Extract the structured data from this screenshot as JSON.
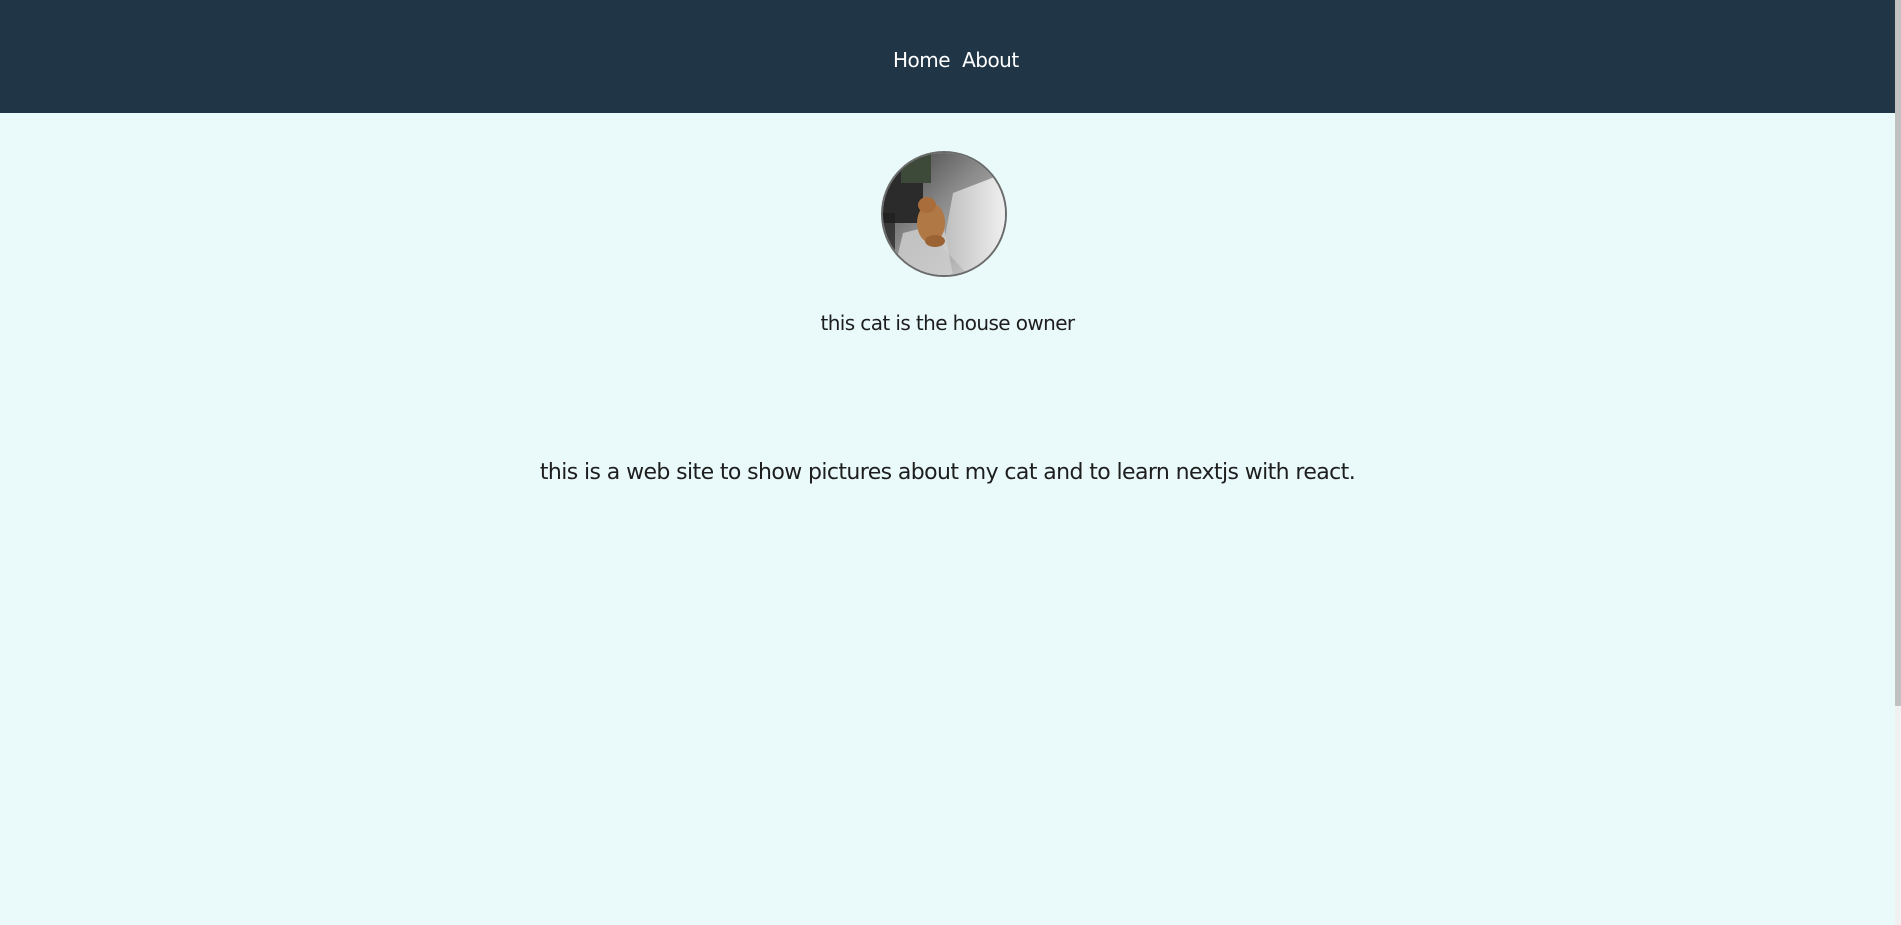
{
  "nav": {
    "home_label": "Home",
    "about_label": "About"
  },
  "avatar": {
    "alt": "cat picture"
  },
  "caption": "this cat is the house owner",
  "description": "this is a web site to show pictures about my cat and to learn nextjs with react.",
  "colors": {
    "navbar_bg": "#203647",
    "page_bg": "#eafafa",
    "nav_text": "#ffffff",
    "body_text": "#1e1e1e"
  }
}
